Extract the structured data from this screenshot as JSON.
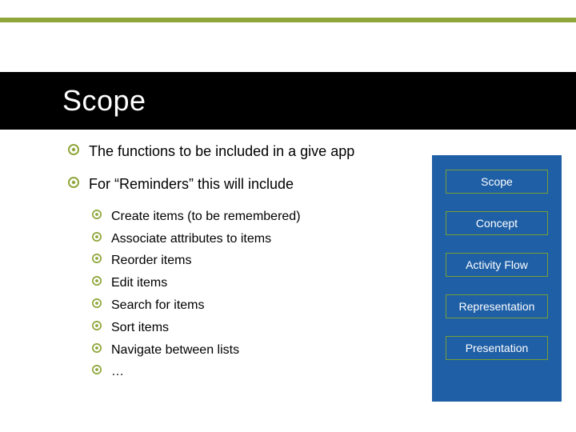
{
  "title": "Scope",
  "bullets_lvl1": [
    "The functions to be included in a give app",
    "For “Reminders” this will include"
  ],
  "bullets_lvl2": [
    "Create items (to be remembered)",
    "Associate attributes to items",
    "Reorder items",
    "Edit items",
    "Search for items",
    "Sort items",
    "Navigate between lists",
    "…"
  ],
  "side_boxes": [
    "Scope",
    "Concept",
    "Activity Flow",
    "Representation",
    "Presentation"
  ],
  "colors": {
    "accent": "#8fa63b",
    "title_band": "#000000",
    "panel": "#1e5fa6",
    "box_border": "#769f34"
  }
}
